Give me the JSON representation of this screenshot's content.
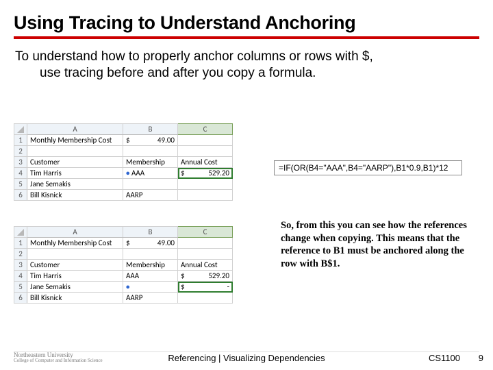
{
  "title": "Using Tracing to Understand Anchoring",
  "body_line1": "To understand how to properly anchor columns or rows with $,",
  "body_line2": "use tracing before and after you copy a formula.",
  "formula": "=IF(OR(B4=\"AAA\",B4=\"AARP\"),B1*0.9,B1)*12",
  "explain": "So, from this you can see how the references change when copying. This means that the reference to B1 must be anchored along the row with B$1.",
  "sheet": {
    "cols": [
      "A",
      "B",
      "C"
    ],
    "rows": [
      "1",
      "2",
      "3",
      "4",
      "5",
      "6"
    ],
    "r1a": "Monthly Membership Cost",
    "r1b_dollar": "$",
    "r1b_val": "49.00",
    "r3a": "Customer",
    "r3b": "Membership",
    "r3c": "Annual Cost",
    "r4a": "Tim Harris",
    "r4b": "AAA",
    "r4c_dollar": "$",
    "r4c_val": "529.20",
    "r5a": "Jane Semakis",
    "r5c_dollar": "$",
    "r5c_val": "-",
    "r6a": "Bill Kisnick",
    "r6b": "AARP"
  },
  "footer": {
    "logo_top": "Northeastern University",
    "logo_sub": "College of Computer and Information Science",
    "center": "Referencing | Visualizing Dependencies",
    "course": "CS1100",
    "page": "9"
  }
}
